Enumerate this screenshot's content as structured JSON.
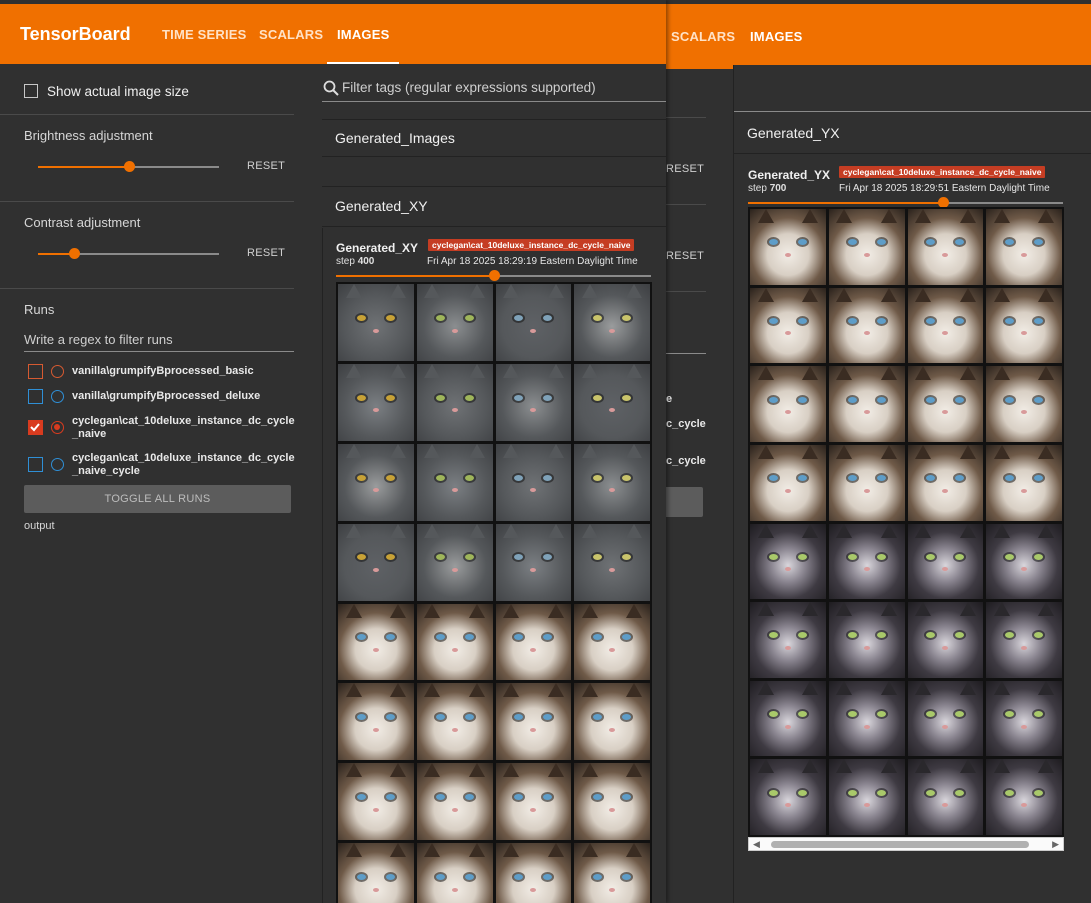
{
  "app": {
    "title": "TensorBoard",
    "tabs": [
      "TIME SERIES",
      "SCALARS",
      "IMAGES"
    ],
    "accent": "#f07000"
  },
  "sidebar": {
    "show_actual_size_label": "Show actual image size",
    "brightness_label": "Brightness adjustment",
    "brightness_value": 0.5,
    "contrast_label": "Contrast adjustment",
    "contrast_value": 0.2,
    "reset_label": "RESET",
    "runs_label": "Runs",
    "runs_filter_placeholder": "Write a regex to filter runs",
    "runs": [
      {
        "name_line1": "vanilla\\grumpifyBprocessed_basic",
        "name_line2": "",
        "color": "#d65a31",
        "checked": false
      },
      {
        "name_line1": "vanilla\\grumpifyBprocessed_deluxe",
        "name_line2": "",
        "color": "#2f8fd6",
        "checked": false
      },
      {
        "name_line1": "cyclegan\\cat_10deluxe_instance_dc_cycle",
        "name_line2": "_naive",
        "color": "#d93b1f",
        "checked": true
      },
      {
        "name_line1": "cyclegan\\cat_10deluxe_instance_dc_cycle",
        "name_line2": "_naive_cycle",
        "color": "#2f8fd6",
        "checked": false
      }
    ],
    "toggle_all_label": "TOGGLE ALL RUNS",
    "output_label": "output"
  },
  "main": {
    "filter_placeholder": "Filter tags (regular expressions supported)",
    "sections": [
      "Generated_Images",
      "Generated_XY"
    ],
    "card_xy": {
      "title": "Generated_XY",
      "step_label": "step",
      "step_value": "400",
      "run_chip": "cyclegan\\cat_10deluxe_instance_dc_cycle_naive",
      "timestamp": "Fri Apr 18 2025 18:29:19 Eastern Daylight Time",
      "slider_value": 0.5
    }
  },
  "back_window": {
    "tabs": [
      "SCALARS",
      "IMAGES"
    ],
    "section": "Generated_YX",
    "reset_label": "RESET",
    "partial_run_1": "e",
    "partial_run_2": "c_cycle",
    "partial_run_3": "c_cycle",
    "card_yx": {
      "title": "Generated_YX",
      "step_label": "step",
      "step_value": "700",
      "run_chip": "cyclegan\\cat_10deluxe_instance_dc_cycle_naive",
      "timestamp": "Fri Apr 18 2025 18:29:51 Eastern Daylight Time",
      "slider_value": 0.62
    }
  }
}
